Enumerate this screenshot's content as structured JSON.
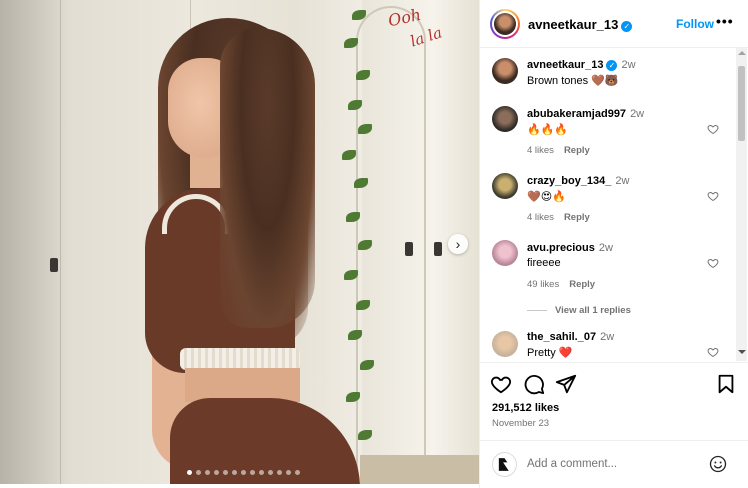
{
  "post": {
    "author": "avneetkaur_13",
    "follow_label": "Follow",
    "more_label": "•••",
    "caption_user": "avneetkaur_13",
    "caption_time": "2w",
    "caption_text": "Brown tones 🤎🐻",
    "likes": "291,512 likes",
    "date": "November 23"
  },
  "media": {
    "neon_line1": "Ooh",
    "neon_line2": "la la",
    "next_label": "›",
    "carousel_count": 13
  },
  "comments": [
    {
      "user": "abubakeramjad997",
      "time": "2w",
      "text": "🔥🔥🔥",
      "likes": "4 likes",
      "reply": "Reply"
    },
    {
      "user": "crazy_boy_134_",
      "time": "2w",
      "text": "🤎😍🔥",
      "likes": "4 likes",
      "reply": "Reply"
    },
    {
      "user": "avu.precious",
      "time": "2w",
      "text": "fireeee",
      "likes": "49 likes",
      "reply": "Reply"
    },
    {
      "user": "the_sahil._07",
      "time": "2w",
      "text": "Pretty ❤️"
    }
  ],
  "view_replies": "View all 1 replies",
  "add_comment": {
    "placeholder": "Add a comment..."
  },
  "colors": {
    "accent": "#0095f6",
    "muted": "#737373",
    "border": "#efefef"
  }
}
